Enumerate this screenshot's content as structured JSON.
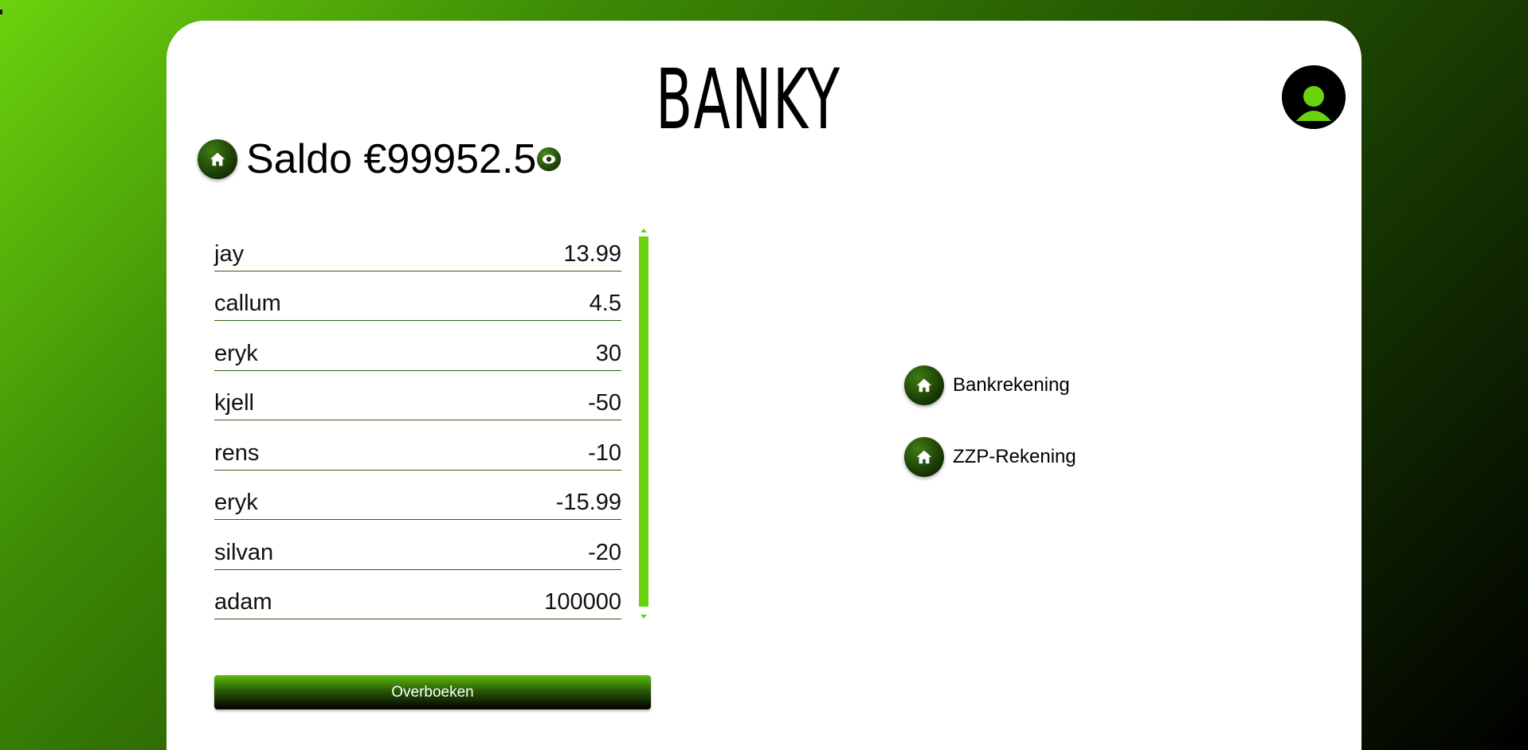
{
  "brand": {
    "name": "BANKY"
  },
  "header": {
    "home_icon": "home-icon",
    "saldo_label": "Saldo €99952.5",
    "visibility_icon": "eye-icon"
  },
  "transactions": [
    {
      "name": "jay",
      "amount": "13.99"
    },
    {
      "name": "callum",
      "amount": "4.5"
    },
    {
      "name": "eryk",
      "amount": "30"
    },
    {
      "name": "kjell",
      "amount": "-50"
    },
    {
      "name": "rens",
      "amount": "-10"
    },
    {
      "name": "eryk",
      "amount": "-15.99"
    },
    {
      "name": "silvan",
      "amount": "-20"
    },
    {
      "name": "adam",
      "amount": "100000"
    }
  ],
  "actions": {
    "transfer_label": "Overboeken"
  },
  "accounts": [
    {
      "label": "Bankrekening",
      "icon": "home-icon"
    },
    {
      "label": "ZZP-Rekening",
      "icon": "home-icon"
    }
  ],
  "profile": {
    "icon": "user-avatar-icon"
  },
  "colors": {
    "accent": "#6cd20e",
    "dark_green": "#1b3d05",
    "background_start": "#6cd20e",
    "background_end": "#000000"
  }
}
